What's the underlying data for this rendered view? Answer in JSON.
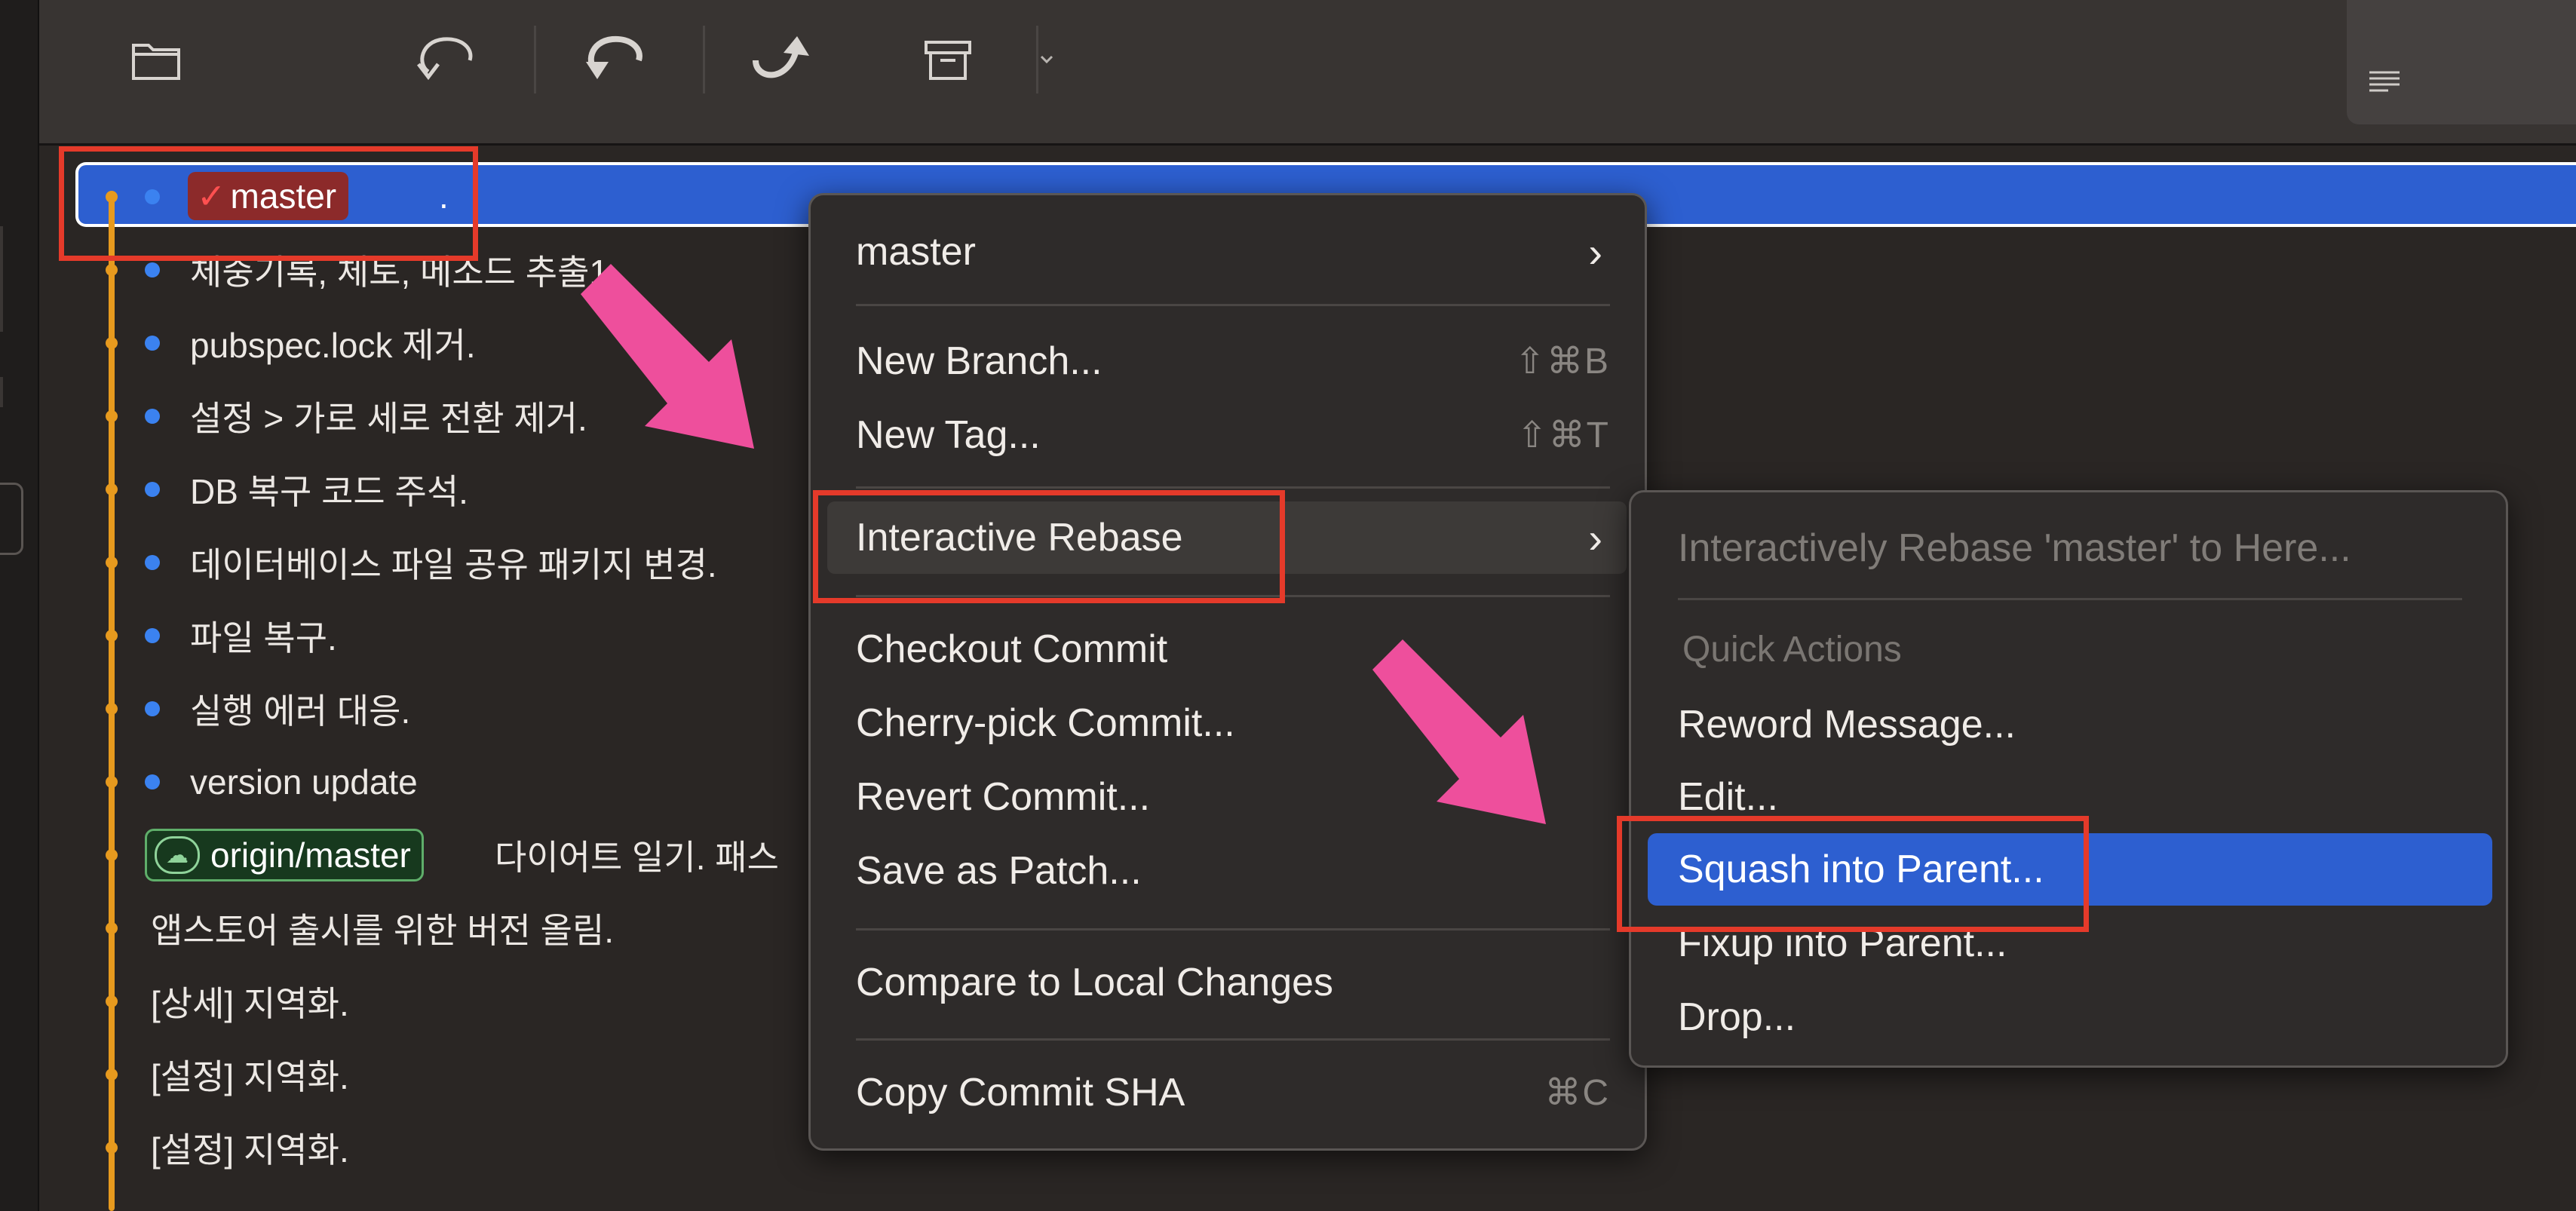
{
  "toolbar": {
    "buttons": [
      {
        "name": "open-folder-icon"
      },
      {
        "name": "fetch-icon"
      },
      {
        "name": "pull-icon"
      },
      {
        "name": "push-icon"
      },
      {
        "name": "stash-icon"
      }
    ]
  },
  "commits": [
    {
      "branch": "master",
      "message": "."
    },
    {
      "message": "체중기록, 체토, 메소드 추출1"
    },
    {
      "message": "pubspec.lock 제거."
    },
    {
      "message": "설정 > 가로 세로 전환 제거."
    },
    {
      "message": "DB 복구 코드 주석."
    },
    {
      "message": "데이터베이스 파일 공유 패키지 변경."
    },
    {
      "message": "파일 복구."
    },
    {
      "message": "실행 에러 대응."
    },
    {
      "message": "version update"
    },
    {
      "remote_branch": "origin/master",
      "message": "다이어트 일기. 패스"
    },
    {
      "message": "앱스토어 출시를 위한 버전 올림."
    },
    {
      "message": "[상세] 지역화."
    },
    {
      "message": "[설정] 지역화."
    },
    {
      "message": "[설정] 지역화."
    }
  ],
  "context_menu": {
    "branch_item": "master",
    "new_branch": "New Branch...",
    "new_branch_shortcut": "⇧⌘B",
    "new_tag": "New Tag...",
    "new_tag_shortcut": "⇧⌘T",
    "interactive_rebase": "Interactive Rebase",
    "checkout_commit": "Checkout Commit",
    "cherry_pick": "Cherry-pick Commit...",
    "revert_commit": "Revert Commit...",
    "save_patch": "Save as Patch...",
    "compare_local": "Compare to Local Changes",
    "copy_sha": "Copy Commit SHA",
    "copy_sha_shortcut": "⌘C"
  },
  "submenu": {
    "rebase_here": "Interactively Rebase 'master' to Here...",
    "quick_actions_header": "Quick Actions",
    "reword": "Reword Message...",
    "edit": "Edit...",
    "squash": "Squash into Parent...",
    "fixup": "Fixup into Parent...",
    "drop": "Drop..."
  },
  "colors": {
    "selection": "#2d5fd0",
    "graph": "#e79a1e",
    "highlight_box": "#e53a2a",
    "annotation_arrow": "#ee4f9c"
  }
}
